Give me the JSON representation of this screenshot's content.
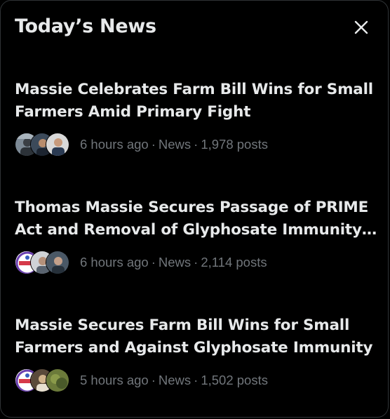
{
  "panel": {
    "title": "Today’s News"
  },
  "news": [
    {
      "title": "Massie Celebrates Farm Bill Wins for Small Farmers Amid Primary Fight",
      "time": "6 hours ago",
      "category": "News",
      "posts": "1,978 posts",
      "separator": "·"
    },
    {
      "title": "Thomas Massie Secures Passage of PRIME Act and Removal of Glyphosate Immunity ...",
      "time": "6 hours ago",
      "category": "News",
      "posts": "2,114 posts",
      "separator": "·"
    },
    {
      "title": "Massie Secures Farm Bill Wins for Small Farmers and Against Glyphosate Immunity",
      "time": "5 hours ago",
      "category": "News",
      "posts": "1,502 posts",
      "separator": "·"
    }
  ],
  "colors": {
    "background": "#000000",
    "text_primary": "#e7e9ea",
    "text_secondary": "#71767b"
  },
  "icons": {
    "close": "close-icon"
  }
}
